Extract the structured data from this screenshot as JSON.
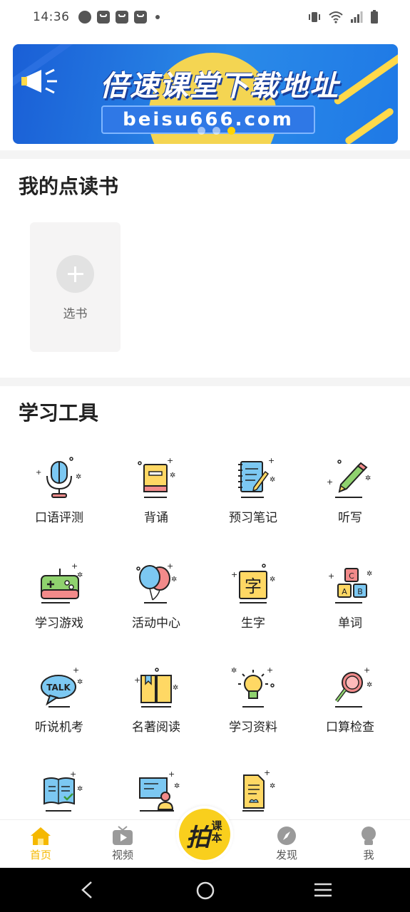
{
  "status_bar": {
    "time": "14:36"
  },
  "banner": {
    "title": "倍速课堂下载地址",
    "url": "beisu666.com",
    "dots": 3,
    "active_dot": 3
  },
  "my_books": {
    "title": "我的点读书",
    "add_label": "选书"
  },
  "tools": {
    "title": "学习工具",
    "items": [
      {
        "label": "口语评测",
        "icon": "microphone-icon"
      },
      {
        "label": "背诵",
        "icon": "book-icon"
      },
      {
        "label": "预习笔记",
        "icon": "notebook-pencil-icon"
      },
      {
        "label": "听写",
        "icon": "pencil-icon"
      },
      {
        "label": "学习游戏",
        "icon": "gamepad-icon"
      },
      {
        "label": "活动中心",
        "icon": "balloons-icon"
      },
      {
        "label": "生字",
        "icon": "character-card-icon"
      },
      {
        "label": "单词",
        "icon": "abc-blocks-icon"
      },
      {
        "label": "听说机考",
        "icon": "talk-bubble-icon"
      },
      {
        "label": "名著阅读",
        "icon": "open-book-icon"
      },
      {
        "label": "学习资料",
        "icon": "lightbulb-icon"
      },
      {
        "label": "口算检查",
        "icon": "magnifier-icon"
      },
      {
        "label": "",
        "icon": "book-check-icon"
      },
      {
        "label": "",
        "icon": "teacher-board-icon"
      },
      {
        "label": "",
        "icon": "document-icon"
      }
    ]
  },
  "bottom_nav": {
    "items": [
      {
        "label": "首页",
        "icon": "home-icon",
        "active": true
      },
      {
        "label": "视频",
        "icon": "tv-play-icon",
        "active": false
      },
      {
        "label": "发现",
        "icon": "compass-icon",
        "active": false
      },
      {
        "label": "我",
        "icon": "user-icon",
        "active": false
      }
    ],
    "center": {
      "big": "拍",
      "small": "课本"
    }
  },
  "colors": {
    "accent": "#f9cf1d",
    "active_nav": "#f5b800",
    "banner_blue": "#1f79e6"
  }
}
